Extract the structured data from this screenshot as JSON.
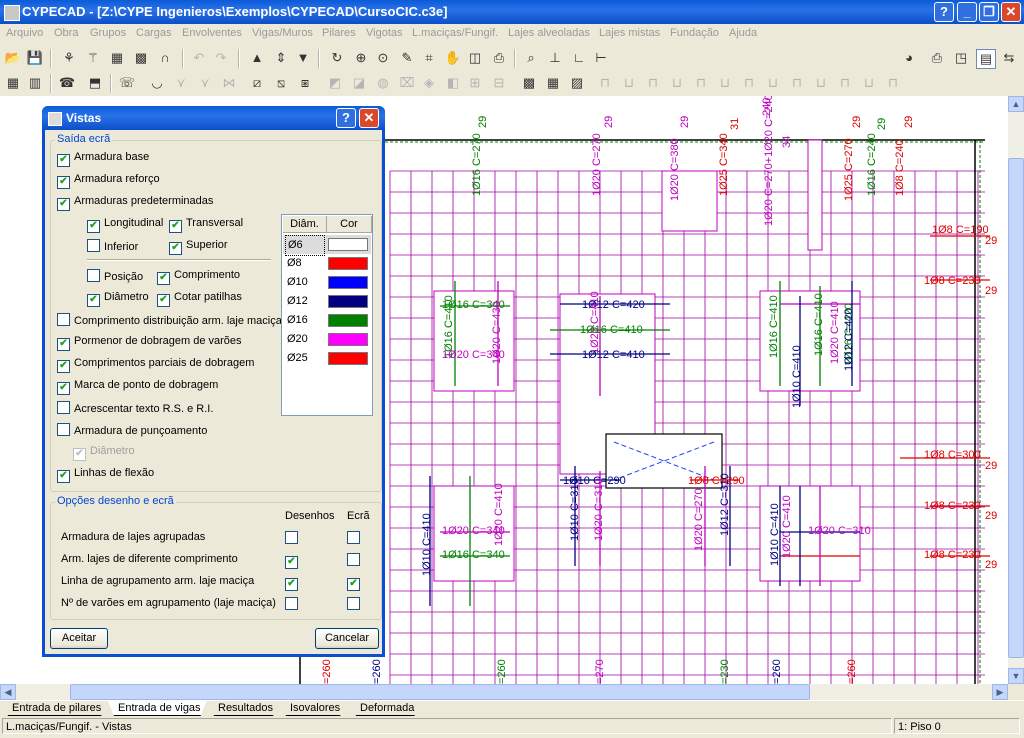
{
  "window": {
    "title": "CYPECAD - [Z:\\CYPE Ingenieros\\Exemplos\\CYPECAD\\CursoCIC.c3e]",
    "help_btn": "?",
    "min_btn": "_",
    "restore_btn": "❐",
    "close_btn": "✕"
  },
  "menu": [
    "Arquivo",
    "Obra",
    "Grupos",
    "Cargas",
    "Envolventes",
    "Vigas/Muros",
    "Pilares",
    "Vigotas",
    "L.maciças/Fungif.",
    "Lajes alveoladas",
    "Lajes mistas",
    "Fundação",
    "Ajuda"
  ],
  "drawing": {
    "colors": {
      "grid": "#a000a0",
      "ph": "#c000c0",
      "red": "#e00000",
      "green": "#008000",
      "blue": "#0000a0",
      "navy": "#000080"
    },
    "labels": [
      {
        "t": "29",
        "c": "green"
      },
      {
        "t": "1Ø16 C=270",
        "c": "green"
      },
      {
        "t": "29",
        "c": "ph"
      },
      {
        "t": "1Ø20 C=270",
        "c": "ph"
      },
      {
        "t": "29",
        "c": "ph"
      },
      {
        "t": "1Ø20 C=380",
        "c": "ph"
      },
      {
        "t": "31",
        "c": "red"
      },
      {
        "t": "1Ø25 C=340",
        "c": "red"
      },
      {
        "t": "240",
        "c": "ph"
      },
      {
        "t": "1Ø20 C=270+1Ø20 C=240",
        "c": "ph"
      },
      {
        "t": "34",
        "c": "ph"
      },
      {
        "t": "29",
        "c": "red"
      },
      {
        "t": "1Ø25 C=270",
        "c": "red"
      },
      {
        "t": "29",
        "c": "green"
      },
      {
        "t": "1Ø16 C=240",
        "c": "green"
      },
      {
        "t": "29",
        "c": "red"
      },
      {
        "t": "1Ø8 C=240",
        "c": "red"
      },
      {
        "t": "1Ø8 C=190",
        "c": "red"
      },
      {
        "t": "29",
        "c": "red"
      },
      {
        "t": "1Ø8 C=230",
        "c": "red"
      },
      {
        "t": "29",
        "c": "red"
      },
      {
        "t": "1Ø16 C=340",
        "c": "green"
      },
      {
        "t": "1Ø12 C=420",
        "c": "navy"
      },
      {
        "t": "1Ø20 C=410",
        "c": "ph"
      },
      {
        "t": "1Ø16 C=410",
        "c": "green"
      },
      {
        "t": "1Ø16 C=410",
        "c": "green"
      },
      {
        "t": "1Ø20 C=340",
        "c": "ph"
      },
      {
        "t": "1Ø12 C=410",
        "c": "navy"
      },
      {
        "t": "1Ø16 C=410",
        "c": "green"
      },
      {
        "t": "1Ø20 C=430",
        "c": "ph"
      },
      {
        "t": "1Ø16 C=410",
        "c": "green"
      },
      {
        "t": "1Ø10 C=410",
        "c": "navy"
      },
      {
        "t": "1Ø20 C=410",
        "c": "ph"
      },
      {
        "t": "1Ø16 C=420",
        "c": "green"
      },
      {
        "t": "1Ø12 C=420",
        "c": "navy"
      },
      {
        "t": "1Ø10 C=290",
        "c": "navy"
      },
      {
        "t": "1Ø20 C=310",
        "c": "ph"
      },
      {
        "t": "1Ø8 C=290",
        "c": "red"
      },
      {
        "t": "1Ø10 C=310",
        "c": "navy"
      },
      {
        "t": "1Ø20 C=270",
        "c": "ph"
      },
      {
        "t": "1Ø12 C=310",
        "c": "navy"
      },
      {
        "t": "1Ø8 C=300",
        "c": "red"
      },
      {
        "t": "29",
        "c": "red"
      },
      {
        "t": "1Ø8 C=230",
        "c": "red"
      },
      {
        "t": "29",
        "c": "red"
      },
      {
        "t": "1Ø20 C=340",
        "c": "ph"
      },
      {
        "t": "1Ø16 C=340",
        "c": "green"
      },
      {
        "t": "1Ø10 C=410",
        "c": "navy"
      },
      {
        "t": "1Ø20 C=410",
        "c": "ph"
      },
      {
        "t": "1Ø10 C=410",
        "c": "navy"
      },
      {
        "t": "1Ø20 C=410",
        "c": "ph"
      },
      {
        "t": "1Ø20 C=310",
        "c": "ph"
      },
      {
        "t": "1Ø8 C=230",
        "c": "red"
      },
      {
        "t": "29",
        "c": "red"
      },
      {
        "t": "=260",
        "c": "navy"
      },
      {
        "t": "=260",
        "c": "red"
      },
      {
        "t": "=260",
        "c": "green"
      },
      {
        "t": "=270",
        "c": "ph"
      },
      {
        "t": "=230",
        "c": "green"
      },
      {
        "t": "=260",
        "c": "navy"
      },
      {
        "t": "=260",
        "c": "red"
      }
    ]
  },
  "dialog": {
    "title": "Vistas",
    "help": "?",
    "close": "✕",
    "group_output": "Saída ecrã",
    "cb_base": "Armadura base",
    "cb_reforco": "Armadura reforço",
    "cb_predet": "Armaduras predeterminadas",
    "cb_long": "Longitudinal",
    "cb_transv": "Transversal",
    "cb_inferior": "Inferior",
    "cb_superior": "Superior",
    "cb_posicao": "Posição",
    "cb_comprimento": "Comprimento",
    "cb_diametro": "Diâmetro",
    "cb_cotar": "Cotar patilhas",
    "cb_compdist": "Comprimento distribuição arm. laje maciça",
    "cb_pormenor": "Pormenor de dobragem de varões",
    "cb_parciais": "Comprimentos parciais de dobragem",
    "cb_marca": "Marca de ponto de dobragem",
    "cb_texto": "Acrescentar texto R.S. e R.I.",
    "cb_punc": "Armadura de punçoamento",
    "cb_punc_diam": "Diâmetro",
    "cb_flexao": "Linhas de flexão",
    "list_hdr_diam": "Diâm.",
    "list_hdr_cor": "Cor",
    "diameters": [
      {
        "name": "Ø6",
        "color": "#ffffff"
      },
      {
        "name": "Ø8",
        "color": "#ff0000"
      },
      {
        "name": "Ø10",
        "color": "#0000ff"
      },
      {
        "name": "Ø12",
        "color": "#000080"
      },
      {
        "name": "Ø16",
        "color": "#008000"
      },
      {
        "name": "Ø20",
        "color": "#ff00ff"
      },
      {
        "name": "Ø25",
        "color": "#ff0000"
      }
    ],
    "group_options": "Opções desenho e ecrã",
    "col_desenhos": "Desenhos",
    "col_ecra": "Ecrã",
    "opt_agrupadas": "Armadura de lajes agrupadas",
    "opt_difcomp": "Arm. lajes de diferente comprimento",
    "opt_linha": "Linha de agrupamento arm. laje maciça",
    "opt_nvaroes": "Nº de varões em agrupamento (laje maciça)",
    "accept": "Aceitar",
    "cancel": "Cancelar"
  },
  "tabs": [
    "Entrada de pilares",
    "Entrada de vigas",
    "Resultados",
    "Isovalores",
    "Deformada"
  ],
  "status": {
    "left": "L.maciças/Fungif. - Vistas",
    "right": "1: Piso 0"
  }
}
